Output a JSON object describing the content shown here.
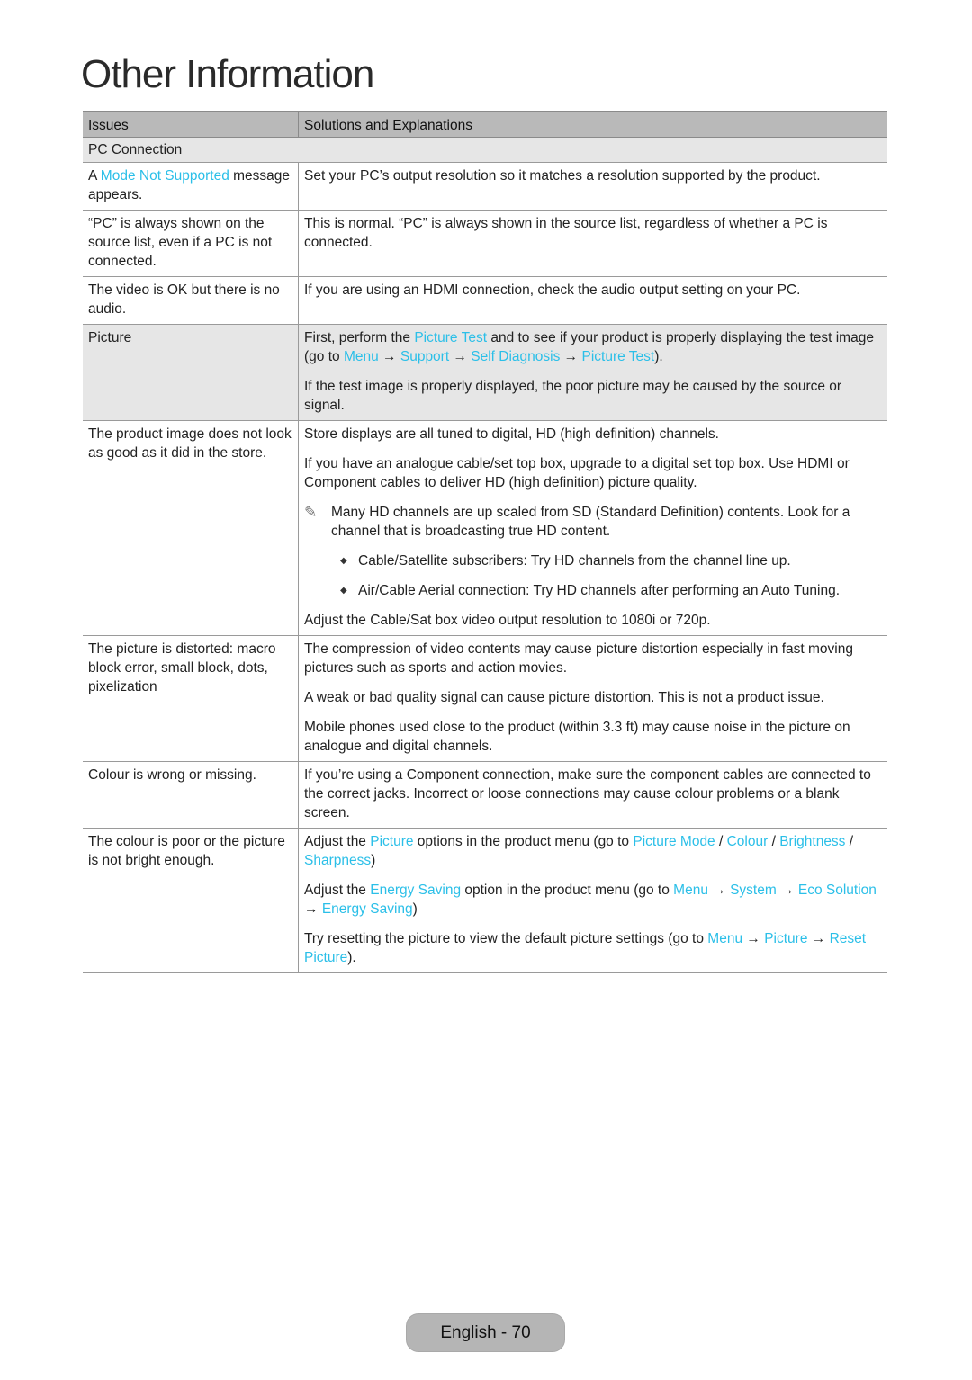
{
  "page": {
    "title": "Other Information",
    "footer": "English - 70"
  },
  "table": {
    "headers": [
      "Issues",
      "Solutions and Explanations"
    ],
    "section_pc": "PC Connection",
    "rows": {
      "mode": {
        "issue_prefix": "A ",
        "issue_link": "Mode Not Supported",
        "issue_suffix": " message appears.",
        "solution": "Set your PC’s output resolution so it matches a resolution supported by the product."
      },
      "pc_shown": {
        "issue": "“PC” is always shown on the source list, even if a PC is not connected.",
        "solution": "This is normal. “PC” is always shown in the source list, regardless of whether a PC is connected."
      },
      "no_audio": {
        "issue": "The video is OK but there is no audio.",
        "solution": "If you are using an HDMI connection, check the audio output setting on your PC."
      },
      "picture": {
        "issue": "Picture",
        "p1": {
          "t1": "First, perform the ",
          "l1": "Picture Test",
          "t2": " and to see if your product is properly displaying the test image (go to ",
          "l2": "Menu",
          "a1": " → ",
          "l3": "Support",
          "a2": " → ",
          "l4": "Self Diagnosis",
          "a3": " → ",
          "l5": "Picture Test",
          "t3": ")."
        },
        "p2": "If the test image is properly displayed, the poor picture may be caused by the source or signal."
      },
      "store": {
        "issue": "The product image does not look as good as it did in the store.",
        "p1": "Store displays are all tuned to digital, HD (high definition) channels.",
        "p2": "If you have an analogue cable/set top box, upgrade to a digital set top box. Use HDMI or Component cables to deliver HD (high definition) picture quality.",
        "note_icon": "✎",
        "note": "Many HD channels are up scaled from SD (Standard Definition) contents. Look for a channel that is broadcasting true HD content.",
        "bullet_icon": "◆",
        "bullets": [
          "Cable/Satellite subscribers: Try HD channels from the channel line up.",
          "Air/Cable Aerial connection: Try HD channels after performing an Auto Tuning."
        ],
        "p3": "Adjust the Cable/Sat box video output resolution to 1080i or 720p."
      },
      "distorted": {
        "issue": "The picture is distorted: macro block error, small block, dots, pixelization",
        "p1": "The compression of video contents may cause picture distortion especially in fast moving pictures such as sports and action movies.",
        "p2": "A weak or bad quality signal can cause picture distortion. This is not a product issue.",
        "p3": "Mobile phones used close to the product (within 3.3 ft) may cause noise in the picture on analogue and digital channels."
      },
      "colour_wrong": {
        "issue": "Colour is wrong or missing.",
        "solution": "If you’re using a Component connection, make sure the component cables are connected to the correct jacks. Incorrect or loose connections may cause colour problems or a blank screen."
      },
      "colour_poor": {
        "issue": "The colour is poor or the picture is not bright enough.",
        "p1": {
          "t1": "Adjust the ",
          "l1": "Picture",
          "t2": " options in the product menu (go to ",
          "l2": "Picture Mode",
          "s1": " / ",
          "l3": "Colour",
          "s2": " / ",
          "l4": "Brightness",
          "s3": " / ",
          "l5": "Sharpness",
          "t3": ")"
        },
        "p2": {
          "t1": "Adjust the ",
          "l1": "Energy Saving",
          "t2": " option in the product menu (go to ",
          "l2": "Menu",
          "a1": " → ",
          "l3": "System",
          "a2": " → ",
          "l4": "Eco Solution",
          "a3": " → ",
          "l5": "Energy Saving",
          "t3": ")"
        },
        "p3": {
          "t1": "Try resetting the picture to view the default picture settings (go to ",
          "l1": "Menu",
          "a1": " → ",
          "l2": "Picture",
          "a2": " → ",
          "l3": "Reset Picture",
          "t2": ")."
        }
      }
    }
  },
  "colors": {
    "link": "#2bbfe8",
    "header_bg": "#b9b9b9",
    "shade_bg": "#e6e6e6",
    "footer_bg": "#b5b5b5"
  }
}
